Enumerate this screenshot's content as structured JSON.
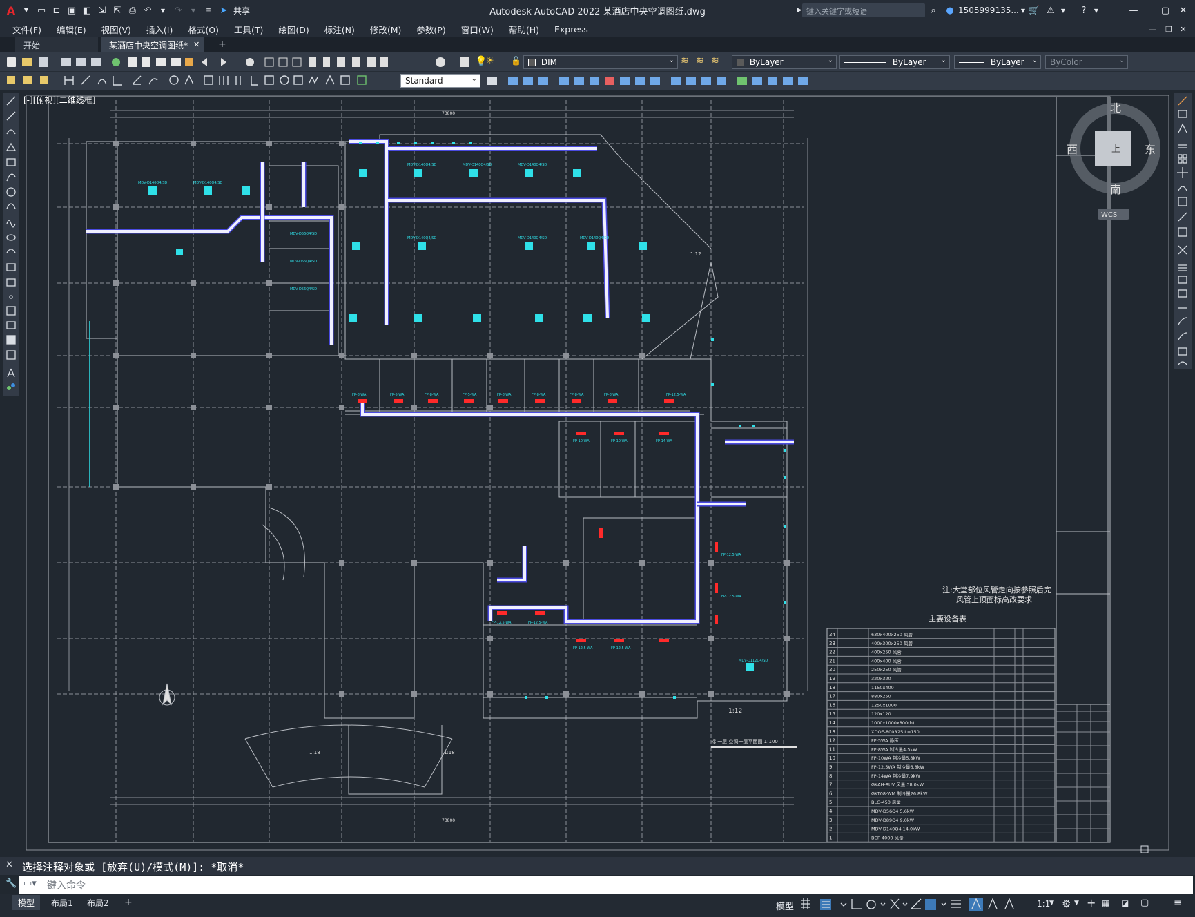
{
  "app": {
    "title": "Autodesk AutoCAD 2022    某酒店中央空调图纸.dwg",
    "share_label": "共享",
    "search_placeholder": "键入关键字或短语",
    "user": "1505999135...",
    "logo": "A"
  },
  "menu": [
    "文件(F)",
    "编辑(E)",
    "视图(V)",
    "插入(I)",
    "格式(O)",
    "工具(T)",
    "绘图(D)",
    "标注(N)",
    "修改(M)",
    "参数(P)",
    "窗口(W)",
    "帮助(H)",
    "Express"
  ],
  "tabs": {
    "start": "开始",
    "active": "某酒店中央空调图纸*",
    "close": "✕",
    "add": "+"
  },
  "ribbon": {
    "layer": "DIM",
    "color": "ByLayer",
    "linetype": "ByLayer",
    "lineweight": "ByLayer",
    "plotstyle": "ByColor",
    "textstyle": "Standard"
  },
  "viewport": {
    "label": "[-][俯视][二维线框]",
    "viewcube": {
      "north": "北",
      "south": "南",
      "east": "东",
      "west": "西",
      "top": "上",
      "wcs": "WCS"
    }
  },
  "drawing": {
    "dim_top": "73800",
    "dim_bottom": "73800",
    "notes_line1": "注:大堂部位风管走向按参照后完",
    "notes_line2": "风管上顶面标高改要求",
    "table_title": "主要设备表",
    "plan_title": "标 一层 空调一层平面图   1:100",
    "scale_a": "1:12",
    "scale_b": "1:12",
    "scale_c": "1:18",
    "scale_d": "1:18",
    "fp_labels": [
      "FP-8-WA",
      "FP-5-WA",
      "FP-8-WA",
      "FP-5-WA",
      "FP-8-WA",
      "FP-8-WA",
      "FP-8-WA",
      "FP-8-WA",
      "FP-12.5-WA",
      "FP-10-WA",
      "FP-10-WA",
      "FP-14-WA",
      "FP-12.5-WA",
      "FP-12.5-WA",
      "FP-12.5-WA",
      "FP-12.5-WA",
      "FP-12.5-WA",
      "FP-12.5-WA"
    ],
    "mdv_labels": [
      "MDV-D140Q4/SD",
      "MDV-D140Q4/SD",
      "MDV-D140Q4/SD",
      "MDV-D140Q4/SD",
      "MDV-D140Q4/SD",
      "MDV-D140Q4/SD",
      "MDV-D140Q4/SD",
      "MDV-D140Q4/SD",
      "MDV-D56Q4/SD",
      "MDV-D56Q4/SD",
      "MDV-D56Q4/SD",
      "MDV-D112Q4/SD"
    ],
    "table_rows": [
      {
        "no": "24",
        "spec": "630x400x250 风管"
      },
      {
        "no": "23",
        "spec": "400x300x250 风管"
      },
      {
        "no": "22",
        "spec": "400x250 风管"
      },
      {
        "no": "21",
        "spec": "400x400 风管"
      },
      {
        "no": "20",
        "spec": "250x250 风管"
      },
      {
        "no": "19",
        "spec": "320x320"
      },
      {
        "no": "18",
        "spec": "1150x400"
      },
      {
        "no": "17",
        "spec": "880x250"
      },
      {
        "no": "16",
        "spec": "1250x1000"
      },
      {
        "no": "15",
        "spec": "120x120"
      },
      {
        "no": "14",
        "spec": "1000x1000x800(h)"
      },
      {
        "no": "13",
        "spec": "XDOE-800R25 L=150"
      },
      {
        "no": "12",
        "spec": "FP-5WA 静压"
      },
      {
        "no": "11",
        "spec": "FP-8WA  制冷量4.5kW"
      },
      {
        "no": "10",
        "spec": "FP-10WA 制冷量5.8kW"
      },
      {
        "no": "9",
        "spec": "FP-12.5WA 制冷量6.8kW"
      },
      {
        "no": "8",
        "spec": "FP-14WA 制冷量7.9kW"
      },
      {
        "no": "7",
        "spec": "GKAH-8UV 风量 38.0kW"
      },
      {
        "no": "6",
        "spec": "GKT08-WM 制冷量26.8kW"
      },
      {
        "no": "5",
        "spec": "BLG-450 风量"
      },
      {
        "no": "4",
        "spec": "MDV-D56Q4 5.6kW"
      },
      {
        "no": "3",
        "spec": "MDV-D89Q4 9.0kW"
      },
      {
        "no": "2",
        "spec": "MDV-D140Q4 14.0kW"
      },
      {
        "no": "1",
        "spec": "BCF-4000 风量"
      }
    ]
  },
  "command": {
    "history": "选择注释对象或 [放弃(U)/模式(M)]: *取消*",
    "input_placeholder": "键入命令"
  },
  "layout_tabs": [
    "模型",
    "布局1",
    "布局2",
    "+"
  ],
  "status": {
    "model_button": "模型",
    "annotation_scale": "1:1"
  },
  "colors": {
    "accent_cyan": "#2fe0e8",
    "background": "#212830",
    "duct_blue": "#4a4adf",
    "unit_red": "#ff2a2a"
  }
}
